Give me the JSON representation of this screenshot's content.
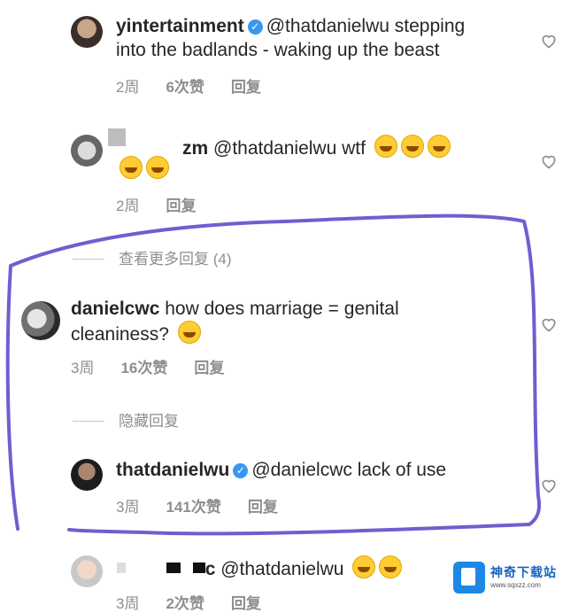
{
  "comments": {
    "c1": {
      "username": "yintertainment",
      "text_a": "@thatdanielwu stepping",
      "text_b": "into the badlands - waking up the beast",
      "time": "2周",
      "likes": "6次赞",
      "reply": "回复"
    },
    "c2": {
      "username_visible": "zm",
      "text_a": "@thatdanielwu wtf",
      "time": "2周",
      "reply": "回复"
    },
    "view_more": "查看更多回复 (4)",
    "c3": {
      "username": "danielcwc",
      "text_a": "how does marriage = genital",
      "text_b": "cleaniness?",
      "time": "3周",
      "likes": "16次赞",
      "reply": "回复"
    },
    "hide_replies": "隐藏回复",
    "c4": {
      "username": "thatdanielwu",
      "text_a": "@danielcwc lack of use",
      "time": "3周",
      "likes": "141次赞",
      "reply": "回复"
    },
    "c5": {
      "username_visible": "c",
      "text_a": "@thatdanielwu",
      "time": "3周",
      "likes": "2次赞",
      "reply": "回复"
    }
  },
  "watermark": {
    "title": "神奇下载站",
    "url": "www.sqxzz.com"
  },
  "colors": {
    "annotation": "#6e5fd0",
    "verified": "#3897f0",
    "meta": "#8e8e8e"
  }
}
